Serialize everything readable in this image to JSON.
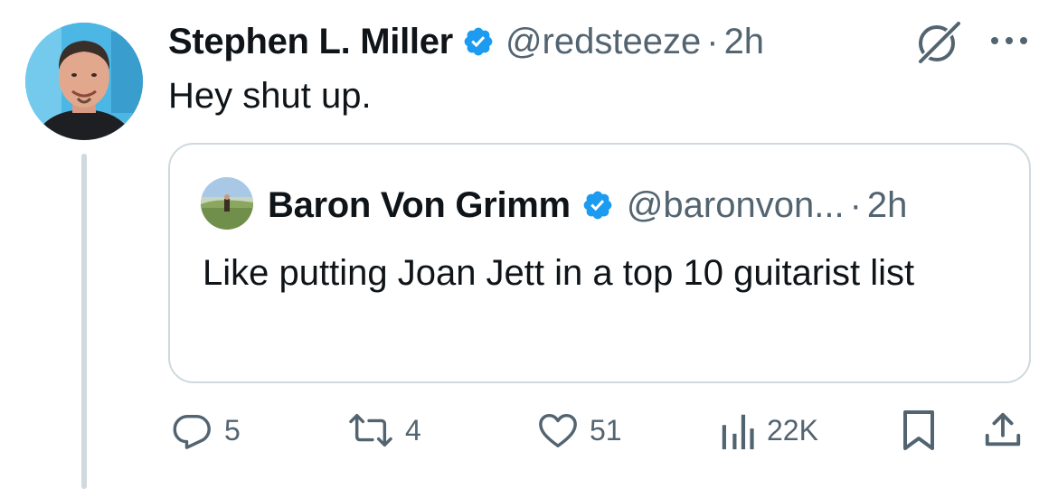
{
  "tweet": {
    "author": {
      "name": "Stephen L. Miller",
      "handle": "@redsteeze",
      "separator": "·",
      "time": "2h",
      "verified": true
    },
    "text": "Hey shut up.",
    "quote": {
      "author": {
        "name": "Baron Von Grimm",
        "handle": "@baronvon...",
        "separator": "·",
        "time": "2h",
        "verified": true
      },
      "text": "Like putting Joan Jett in a top 10 guitarist list"
    },
    "actions": {
      "reply_count": "5",
      "retweet_count": "4",
      "like_count": "51",
      "view_count": "22K"
    }
  },
  "icons": {
    "verified": "verified-badge-icon",
    "grok": "grok-icon",
    "more": "more-horizontal-icon",
    "reply": "reply-icon",
    "retweet": "retweet-icon",
    "like": "heart-icon",
    "views": "views-chart-icon",
    "bookmark": "bookmark-icon",
    "share": "share-icon"
  },
  "colors": {
    "verified_blue": "#1d9bf0",
    "secondary_text": "#536471",
    "primary_text": "#0f1419",
    "border": "#cfd9de"
  }
}
